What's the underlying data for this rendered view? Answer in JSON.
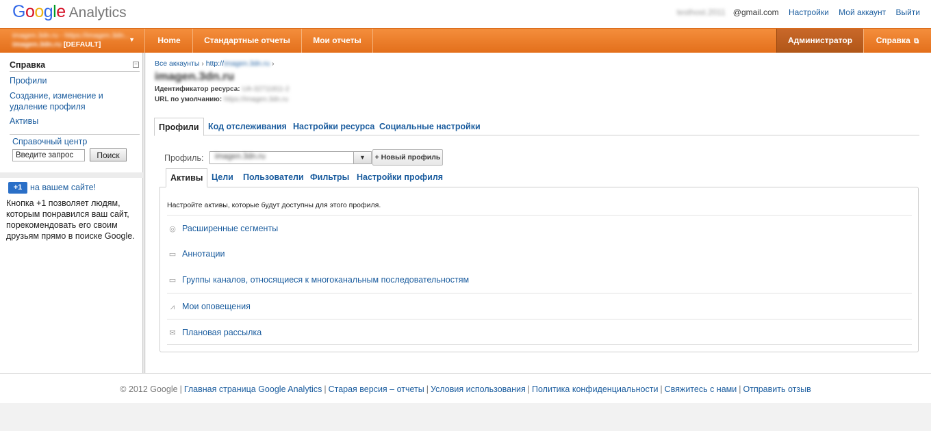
{
  "header": {
    "logo_google": [
      "G",
      "o",
      "o",
      "g",
      "l",
      "e"
    ],
    "logo_product": "Analytics",
    "email_user": "testhost.2011",
    "email_domain": "@gmail.com",
    "links": [
      "Настройки",
      "Мой аккаунт",
      "Выйти"
    ]
  },
  "nav": {
    "account_line1": "imagen.3dn.ru - https://imagen.3dn...",
    "account_line2_name": "imagen.3dn.ru",
    "account_line2_tag": "[DEFAULT]",
    "items": [
      "Home",
      "Стандартные отчеты",
      "Мои отчеты"
    ],
    "admin": "Администратор",
    "help": "Справка"
  },
  "sidebar": {
    "title": "Справка",
    "links": [
      "Профили",
      "Создание, изменение и удаление профиля",
      "Активы"
    ],
    "help_center": "Справочный центр",
    "search_placeholder": "Введите запрос",
    "search_button": "Поиск",
    "plus_badge": "+1",
    "plus_link": "на вашем сайте!",
    "plus_text": "Кнопка +1 позволяет людям, которым понравился ваш сайт, порекомендовать его своим друзьям прямо в поиске Google."
  },
  "main": {
    "breadcrumb_all": "Все аккаунты",
    "breadcrumb_sep": "›",
    "breadcrumb_site_prefix": "http://",
    "breadcrumb_site": "imagen.3dn.ru",
    "title": "imagen.3dn.ru",
    "resource_id_label": "Идентификатор ресурса:",
    "resource_id_value": "UA-32711811-2",
    "default_url_label": "URL по умолчанию:",
    "default_url_value": "https://imagen.3dn.ru",
    "tabs": [
      "Профили",
      "Код отслеживания",
      "Настройки ресурса",
      "Социальные настройки"
    ],
    "profile_label": "Профиль:",
    "profile_value": "imagen.3dn.ru",
    "new_profile_button": "+ Новый профиль",
    "subtabs": [
      "Активы",
      "Цели",
      "Пользователи",
      "Фильтры",
      "Настройки профиля"
    ],
    "panel_description": "Настройте активы, которые будут доступны для этого профиля.",
    "assets": [
      {
        "label": "Расширенные сегменты",
        "icon": "segment-icon"
      },
      {
        "label": "Аннотации",
        "icon": "annotation-icon"
      },
      {
        "label": "Группы каналов, относящиеся к многоканальным последовательностям",
        "icon": "channel-group-icon"
      },
      {
        "label": "Мои оповещения",
        "icon": "alert-icon"
      },
      {
        "label": "Плановая рассылка",
        "icon": "mail-icon"
      }
    ]
  },
  "footer": {
    "copyright": "© 2012 Google",
    "links": [
      "Главная страница Google Analytics",
      "Старая версия – отчеты",
      "Условия использования",
      "Политика конфиденциальности",
      "Свяжитесь с нами",
      "Отправить отзыв"
    ],
    "separator": "|"
  }
}
